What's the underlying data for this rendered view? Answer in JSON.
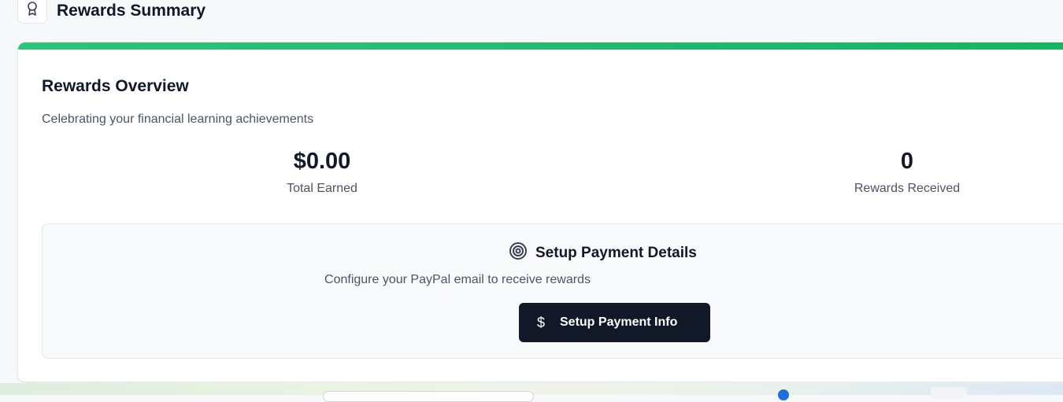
{
  "header": {
    "title": "Rewards Summary",
    "icon": "award-icon"
  },
  "card": {
    "accent_color": "#22c55e",
    "title": "Rewards Overview",
    "subtitle": "Celebrating your financial learning achievements",
    "stats": [
      {
        "value": "$0.00",
        "label": "Total Earned"
      },
      {
        "value": "0",
        "label": "Rewards Received"
      }
    ]
  },
  "setup": {
    "icon": "target-icon",
    "title": "Setup Payment Details",
    "description": "Configure your PayPal email to receive rewards",
    "button_icon": "dollar-icon",
    "button_label": "Setup Payment Info"
  }
}
